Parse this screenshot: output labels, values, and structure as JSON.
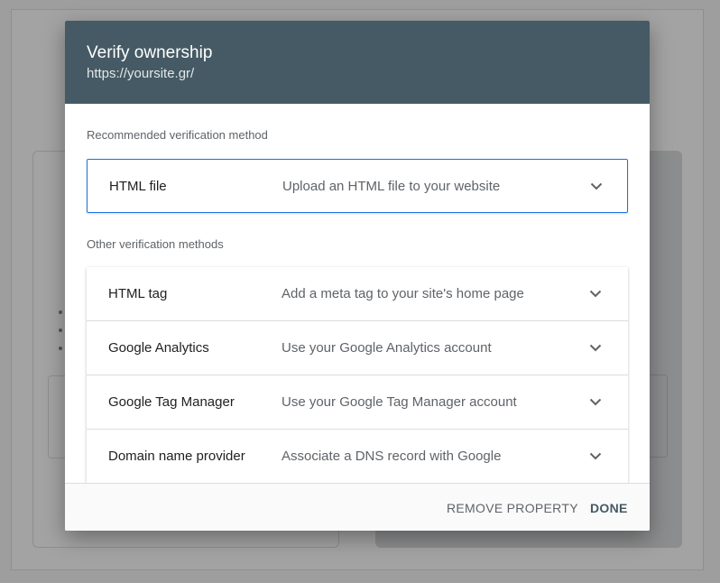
{
  "dialog": {
    "title": "Verify ownership",
    "subtitle": "https://yoursite.gr/"
  },
  "recommended": {
    "section_label": "Recommended verification method",
    "method": {
      "name": "HTML file",
      "description": "Upload an HTML file to your website",
      "icon": "chevron-down-icon"
    }
  },
  "other": {
    "section_label": "Other verification methods",
    "methods": [
      {
        "name": "HTML tag",
        "description": "Add a meta tag to your site's home page",
        "icon": "chevron-down-icon"
      },
      {
        "name": "Google Analytics",
        "description": "Use your Google Analytics account",
        "icon": "chevron-down-icon"
      },
      {
        "name": "Google Tag Manager",
        "description": "Use your Google Tag Manager account",
        "icon": "chevron-down-icon"
      },
      {
        "name": "Domain name provider",
        "description": "Associate a DNS record with Google",
        "icon": "chevron-down-icon"
      }
    ]
  },
  "footer": {
    "remove_label": "REMOVE PROPERTY",
    "done_label": "DONE"
  },
  "colors": {
    "header_bg": "#455a64",
    "accent_border": "#1a73e8",
    "overlay": "#9e9e9e"
  }
}
